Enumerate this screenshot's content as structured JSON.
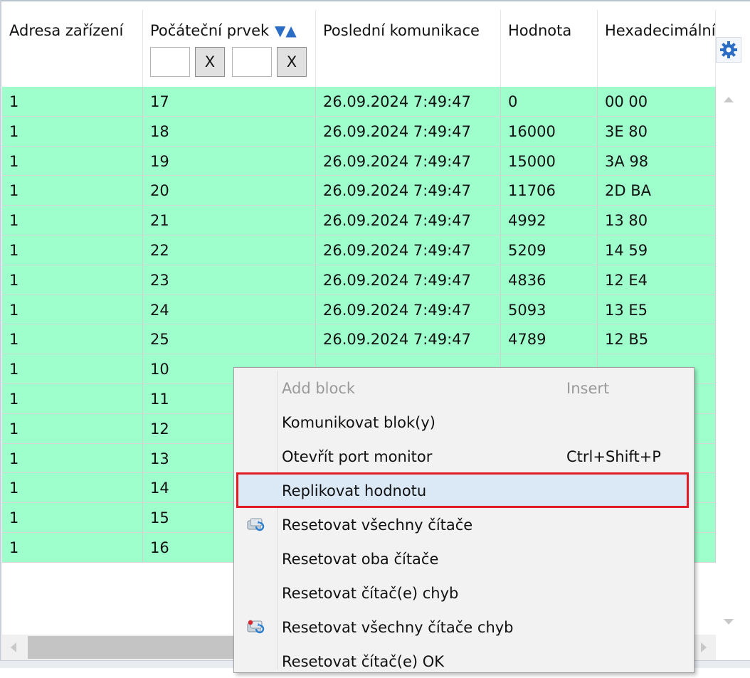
{
  "columns": [
    {
      "label": "Adresa zařízení"
    },
    {
      "label": "Počáteční prvek",
      "sort_icons": "▼▲"
    },
    {
      "label": "Poslední komunikace"
    },
    {
      "label": "Hodnota"
    },
    {
      "label": "Hexadecimální"
    }
  ],
  "filters": {
    "clear_a": "X",
    "clear_b": "X"
  },
  "rows": [
    {
      "addr": "1",
      "start": "17",
      "last": "26.09.2024 7:49:47",
      "value": "0",
      "hex": "00 00"
    },
    {
      "addr": "1",
      "start": "18",
      "last": "26.09.2024 7:49:47",
      "value": "16000",
      "hex": "3E 80"
    },
    {
      "addr": "1",
      "start": "19",
      "last": "26.09.2024 7:49:47",
      "value": "15000",
      "hex": "3A 98"
    },
    {
      "addr": "1",
      "start": "20",
      "last": "26.09.2024 7:49:47",
      "value": "11706",
      "hex": "2D BA"
    },
    {
      "addr": "1",
      "start": "21",
      "last": "26.09.2024 7:49:47",
      "value": "4992",
      "hex": "13 80"
    },
    {
      "addr": "1",
      "start": "22",
      "last": "26.09.2024 7:49:47",
      "value": "5209",
      "hex": "14 59"
    },
    {
      "addr": "1",
      "start": "23",
      "last": "26.09.2024 7:49:47",
      "value": "4836",
      "hex": "12 E4"
    },
    {
      "addr": "1",
      "start": "24",
      "last": "26.09.2024 7:49:47",
      "value": "5093",
      "hex": "13 E5"
    },
    {
      "addr": "1",
      "start": "25",
      "last": "26.09.2024 7:49:47",
      "value": "4789",
      "hex": "12 B5"
    },
    {
      "addr": "1",
      "start": "10",
      "last": "",
      "value": "",
      "hex": ""
    },
    {
      "addr": "1",
      "start": "11",
      "last": "",
      "value": "",
      "hex": ""
    },
    {
      "addr": "1",
      "start": "12",
      "last": "",
      "value": "",
      "hex": ""
    },
    {
      "addr": "1",
      "start": "13",
      "last": "",
      "value": "",
      "hex": ""
    },
    {
      "addr": "1",
      "start": "14",
      "last": "",
      "value": "",
      "hex": ""
    },
    {
      "addr": "1",
      "start": "15",
      "last": "",
      "value": "",
      "hex": ""
    },
    {
      "addr": "1",
      "start": "16",
      "last": "",
      "value": "",
      "hex": ""
    }
  ],
  "context_menu": {
    "items": [
      {
        "label": "Add block",
        "shortcut": "Insert",
        "disabled": true
      },
      {
        "label": "Komunikovat blok(y)",
        "shortcut": ""
      },
      {
        "label": "Otevřít port monitor",
        "shortcut": "Ctrl+Shift+P"
      },
      {
        "label": "Replikovat hodnotu",
        "shortcut": "",
        "highlighted": true
      },
      {
        "label": "Resetovat všechny čítače",
        "shortcut": "",
        "icon": "reset-counters-icon"
      },
      {
        "label": "Resetovat oba čítače",
        "shortcut": ""
      },
      {
        "label": "Resetovat čítač(e) chyb",
        "shortcut": ""
      },
      {
        "label": "Resetovat všechny čítače chyb",
        "shortcut": "",
        "icon": "reset-error-counters-icon"
      },
      {
        "label": "Resetovat čítač(e) OK",
        "shortcut": ""
      }
    ]
  },
  "colors": {
    "row_bg": "#9effcd",
    "highlight_border": "#e11c24",
    "sort_icon": "#2b6cc4"
  }
}
